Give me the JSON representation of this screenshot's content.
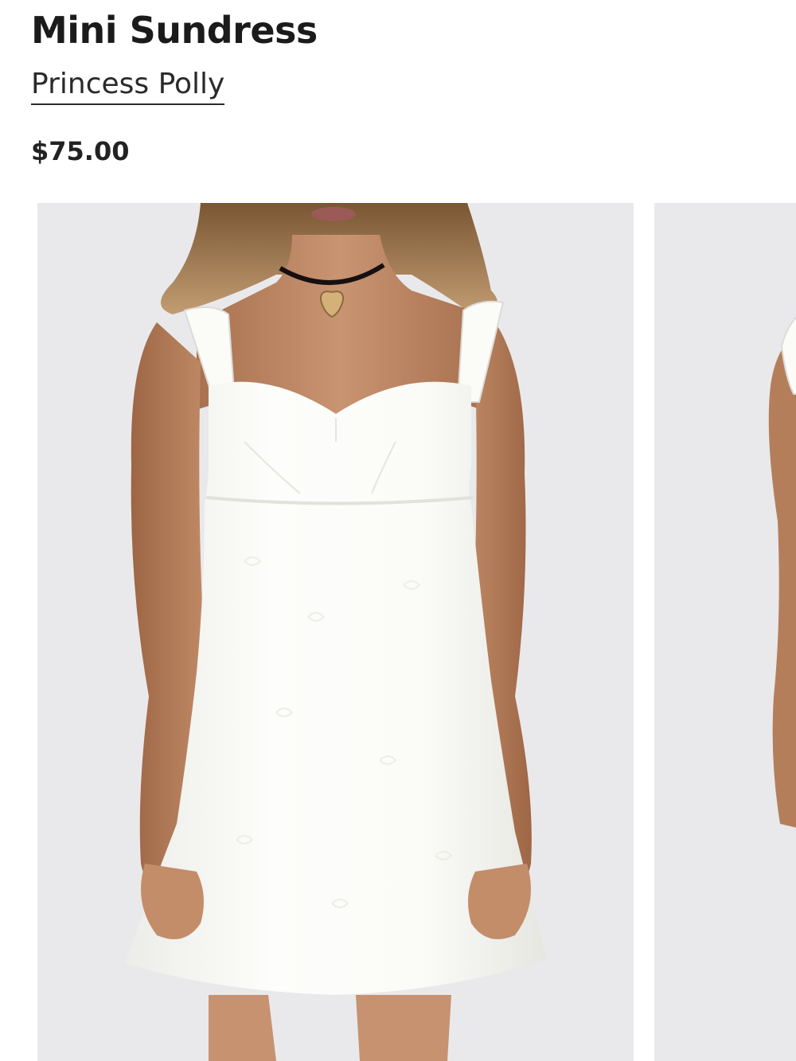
{
  "product": {
    "title": "Mini Sundress",
    "brand": "Princess Polly",
    "price": "$75.00"
  },
  "gallery": {
    "images": [
      {
        "name": "product-image-front"
      },
      {
        "name": "product-image-side"
      }
    ]
  },
  "colors": {
    "photo_background": "#e9e9eb",
    "dress": "#fbfbf8",
    "skin": "#c48f6b",
    "text": "#1b1b1b"
  }
}
